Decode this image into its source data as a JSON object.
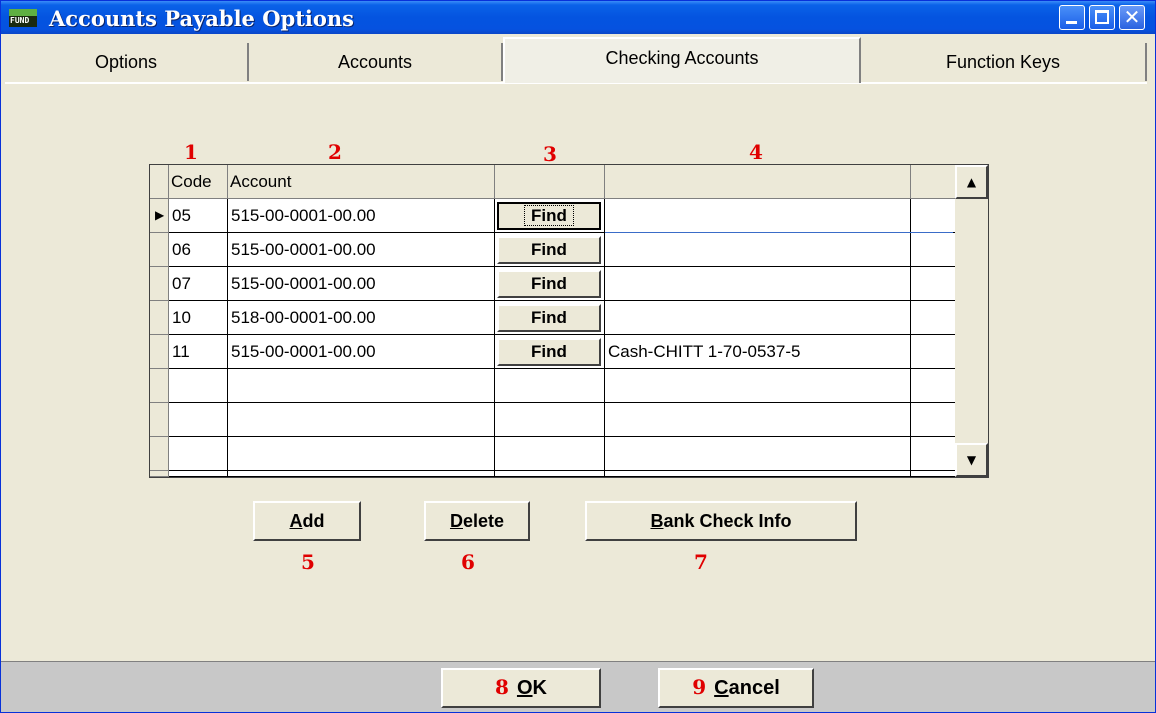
{
  "window": {
    "title": "Accounts Payable Options",
    "icon_label": "FUND",
    "controls": {
      "minimize": "minimize-icon",
      "maximize": "maximize-icon",
      "close": "close-icon"
    }
  },
  "tabs": [
    {
      "label": "Options",
      "active": false
    },
    {
      "label": "Accounts",
      "active": false
    },
    {
      "label": "Checking Accounts",
      "active": true
    },
    {
      "label": "Function Keys",
      "active": false
    }
  ],
  "callouts": {
    "c1": "1",
    "c2": "2",
    "c3": "3",
    "c4": "4",
    "c5": "5",
    "c6": "6",
    "c7": "7",
    "c8": "8",
    "c9": "9"
  },
  "grid": {
    "headers": {
      "code": "Code",
      "account": "Account",
      "find": "",
      "description": "",
      "extra": ""
    },
    "find_label": "Find",
    "rows": [
      {
        "code": "05",
        "account": "515-00-0001-00.00",
        "description": ""
      },
      {
        "code": "06",
        "account": "515-00-0001-00.00",
        "description": ""
      },
      {
        "code": "07",
        "account": "515-00-0001-00.00",
        "description": ""
      },
      {
        "code": "10",
        "account": "518-00-0001-00.00",
        "description": ""
      },
      {
        "code": "11",
        "account": "515-00-0001-00.00",
        "description": "Cash-CHITT 1-70-0537-5"
      }
    ],
    "scroll_up": "▲",
    "scroll_down": "▼",
    "row_pointer": "▶"
  },
  "actions": {
    "add_mnemonic": "A",
    "add_rest": "dd",
    "delete_mnemonic": "D",
    "delete_rest": "elete",
    "bank_mnemonic": "B",
    "bank_rest": "ank Check Info"
  },
  "footer": {
    "ok_mnemonic": "O",
    "ok_rest": "K",
    "cancel_mnemonic": "C",
    "cancel_rest": "ancel"
  }
}
